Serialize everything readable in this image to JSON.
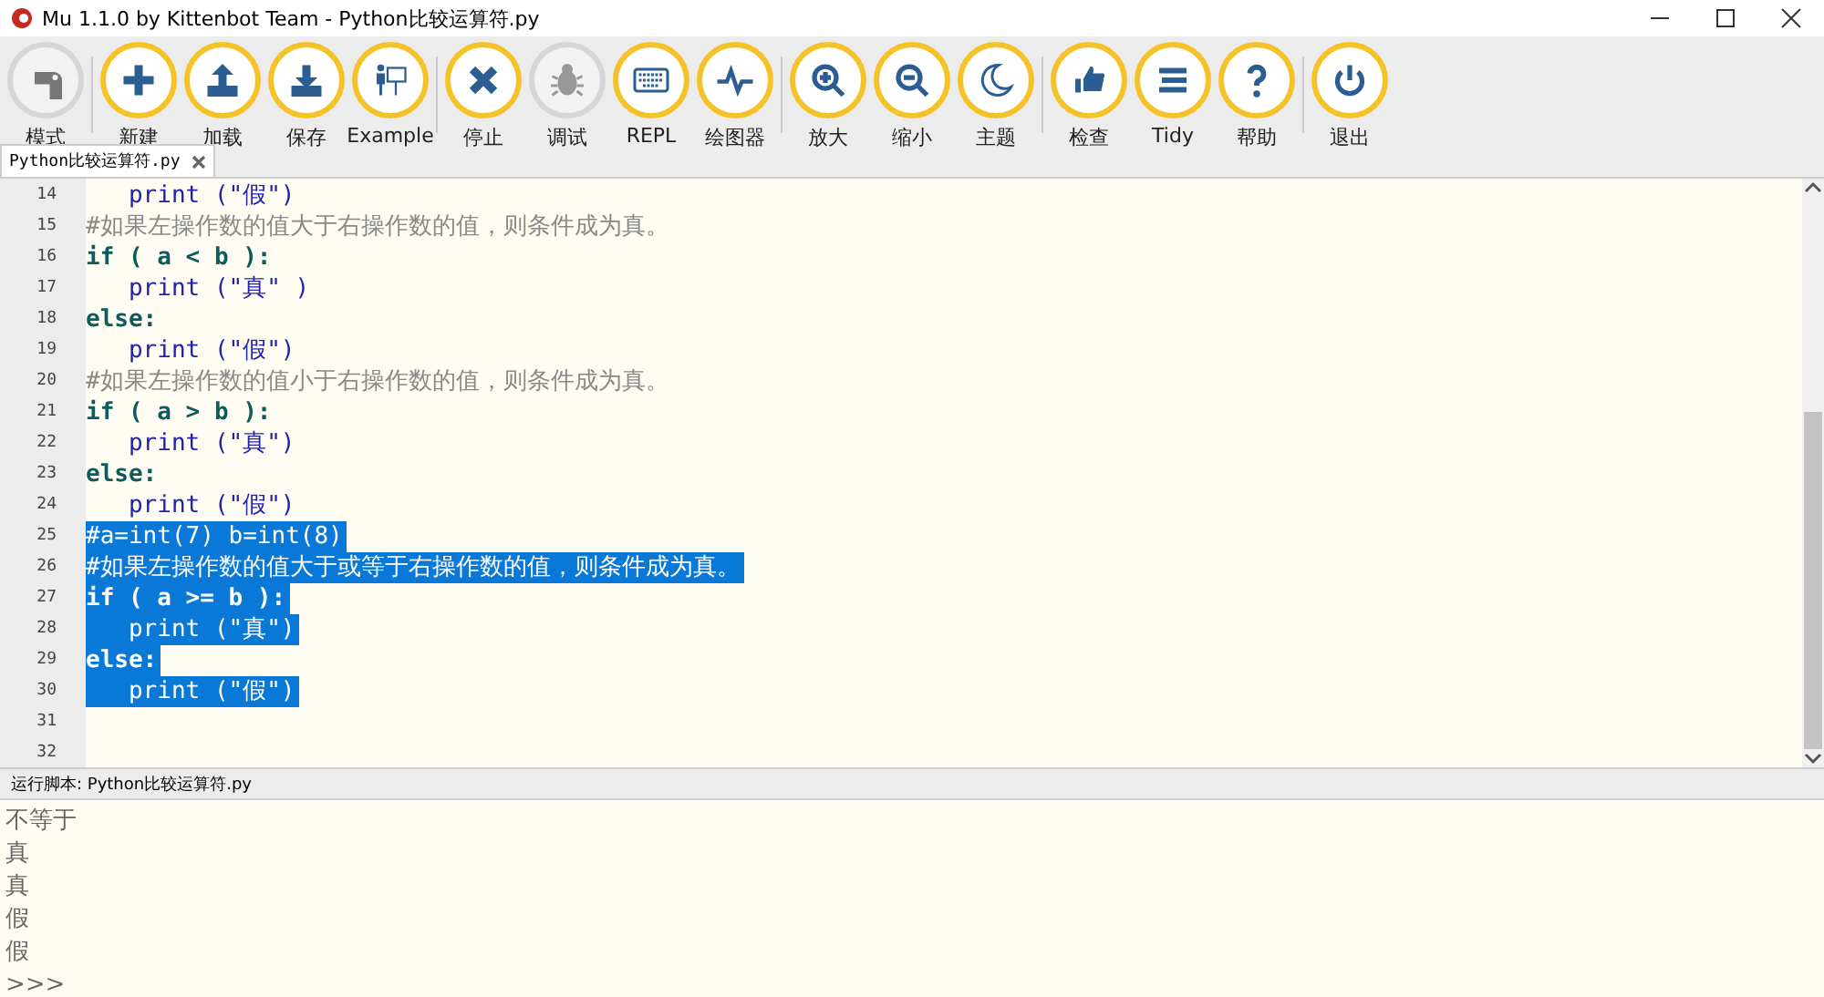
{
  "window": {
    "title": "Mu 1.1.0 by Kittenbot Team - Python比较运算符.py"
  },
  "toolbar": {
    "groups": [
      [
        {
          "label": "模式",
          "disabled": true
        }
      ],
      [
        {
          "label": "新建",
          "disabled": false
        },
        {
          "label": "加载",
          "disabled": false
        },
        {
          "label": "保存",
          "disabled": false
        },
        {
          "label": "Example",
          "disabled": false
        }
      ],
      [
        {
          "label": "停止",
          "disabled": false
        },
        {
          "label": "调试",
          "disabled": true
        },
        {
          "label": "REPL",
          "disabled": false
        },
        {
          "label": "绘图器",
          "disabled": false
        }
      ],
      [
        {
          "label": "放大",
          "disabled": false
        },
        {
          "label": "缩小",
          "disabled": false
        },
        {
          "label": "主题",
          "disabled": false
        }
      ],
      [
        {
          "label": "检查",
          "disabled": false
        },
        {
          "label": "Tidy",
          "disabled": false
        },
        {
          "label": "帮助",
          "disabled": false
        }
      ],
      [
        {
          "label": "退出",
          "disabled": false
        }
      ]
    ]
  },
  "tabs": [
    {
      "label": "Python比较运算符.py",
      "selected": true
    }
  ],
  "editor": {
    "lines": [
      {
        "number": "14",
        "text": "   print (\"假\")",
        "kind": "call",
        "selected": false
      },
      {
        "number": "15",
        "text": "#如果左操作数的值大于右操作数的值，则条件成为真。",
        "kind": "comment",
        "selected": false
      },
      {
        "number": "16",
        "text": "if ( a < b ):",
        "kind": "keyword",
        "selected": false
      },
      {
        "number": "17",
        "text": "   print (\"真\" )",
        "kind": "call",
        "selected": false
      },
      {
        "number": "18",
        "text": "else:",
        "kind": "keyword",
        "selected": false
      },
      {
        "number": "19",
        "text": "   print (\"假\")",
        "kind": "call",
        "selected": false
      },
      {
        "number": "20",
        "text": "#如果左操作数的值小于右操作数的值，则条件成为真。",
        "kind": "comment",
        "selected": false
      },
      {
        "number": "21",
        "text": "if ( a > b ):",
        "kind": "keyword",
        "selected": false
      },
      {
        "number": "22",
        "text": "   print (\"真\")",
        "kind": "call",
        "selected": false
      },
      {
        "number": "23",
        "text": "else:",
        "kind": "keyword",
        "selected": false
      },
      {
        "number": "24",
        "text": "   print (\"假\")",
        "kind": "call",
        "selected": false
      },
      {
        "number": "25",
        "text": "#a=int(7) b=int(8)",
        "kind": "comment",
        "selected": true
      },
      {
        "number": "26",
        "text": "#如果左操作数的值大于或等于右操作数的值，则条件成为真。",
        "kind": "comment",
        "selected": true
      },
      {
        "number": "27",
        "text": "if ( a >= b ):",
        "kind": "keyword",
        "selected": true
      },
      {
        "number": "28",
        "text": "   print (\"真\")",
        "kind": "call",
        "selected": true
      },
      {
        "number": "29",
        "text": "else:",
        "kind": "keyword",
        "selected": true
      },
      {
        "number": "30",
        "text": "   print (\"假\")",
        "kind": "call",
        "selected": true
      },
      {
        "number": "31",
        "kind": "blank",
        "selected": false
      },
      {
        "number": "32",
        "kind": "blank",
        "selected": false
      }
    ]
  },
  "run_pane": {
    "title": "运行脚本: Python比较运算符.py",
    "output": [
      "不等于",
      "真",
      "真",
      "假",
      "假",
      ">>>"
    ]
  }
}
